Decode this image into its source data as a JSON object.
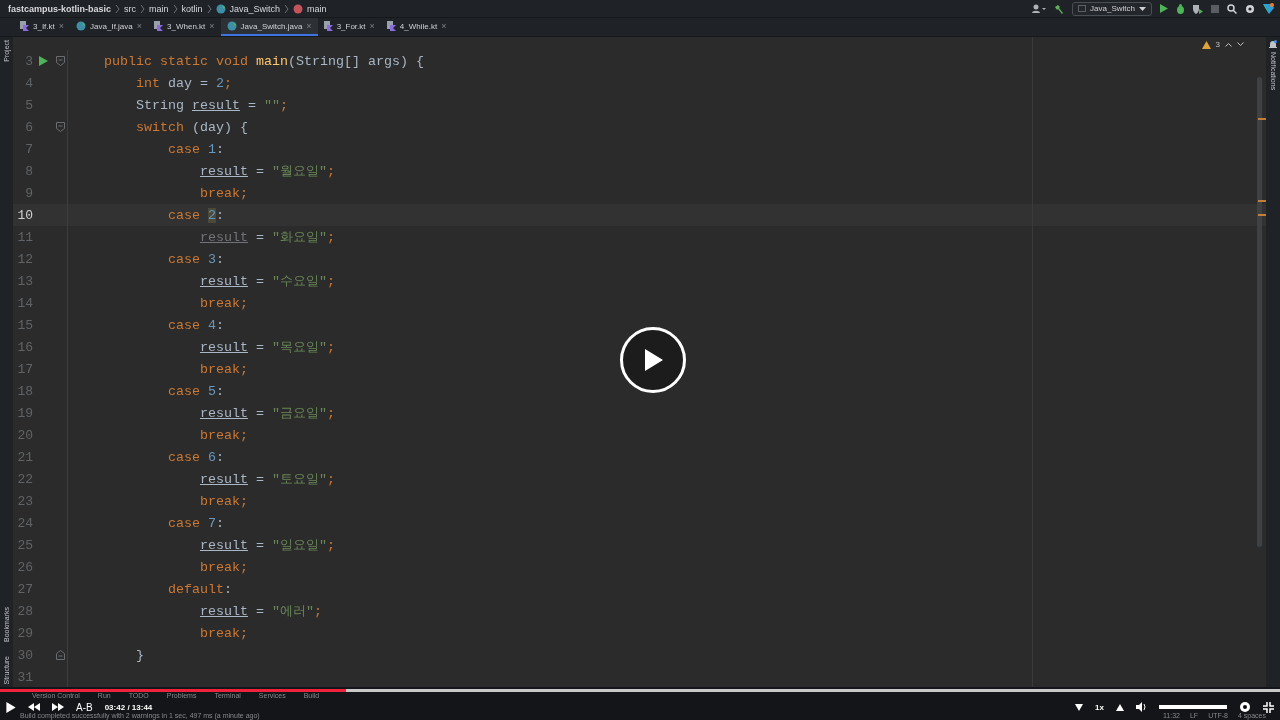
{
  "breadcrumbs": [
    {
      "label": "fastcampus-kotlin-basic",
      "kind": "project"
    },
    {
      "label": "src",
      "kind": "folder"
    },
    {
      "label": "main",
      "kind": "folder"
    },
    {
      "label": "kotlin",
      "kind": "folder"
    },
    {
      "label": "Java_Switch",
      "kind": "class"
    },
    {
      "label": "main",
      "kind": "method"
    }
  ],
  "run_config": {
    "label": "Java_Switch"
  },
  "tabs": [
    {
      "label": "3_If.kt",
      "kind": "kotlin",
      "close": "×",
      "selected": false
    },
    {
      "label": "Java_If.java",
      "kind": "java",
      "close": "×",
      "selected": false
    },
    {
      "label": "3_When.kt",
      "kind": "kotlin",
      "close": "×",
      "selected": false
    },
    {
      "label": "Java_Switch.java",
      "kind": "java",
      "close": "×",
      "selected": true
    },
    {
      "label": "3_For.kt",
      "kind": "kotlin",
      "close": "×",
      "selected": false
    },
    {
      "label": "4_While.kt",
      "kind": "kotlin",
      "close": "×",
      "selected": false
    }
  ],
  "left_tools": {
    "top": "Project",
    "bottom": [
      "Bookmarks",
      "Structure"
    ]
  },
  "right_tools": {
    "top": "Notifications"
  },
  "inspections": {
    "warnings": "3"
  },
  "code_lines": [
    {
      "number": "3",
      "current": false,
      "run": true,
      "fold_start": true,
      "tokens": [
        {
          "text": "    public static void ",
          "kind": "kw"
        },
        {
          "text": "main",
          "kind": "fn"
        },
        {
          "text": "(String[] args) {",
          "kind": "plain"
        }
      ]
    },
    {
      "number": "4",
      "current": false,
      "tokens": [
        {
          "text": "        int",
          "kind": "kw"
        },
        {
          "text": " day = ",
          "kind": "plain"
        },
        {
          "text": "2",
          "kind": "num"
        },
        {
          "text": ";",
          "kind": "kw"
        }
      ]
    },
    {
      "number": "5",
      "current": false,
      "tokens": [
        {
          "text": "        String ",
          "kind": "plain"
        },
        {
          "text": "result",
          "kind": "var"
        },
        {
          "text": " = ",
          "kind": "plain"
        },
        {
          "text": "\"\"",
          "kind": "str"
        },
        {
          "text": ";",
          "kind": "kw"
        }
      ]
    },
    {
      "number": "6",
      "current": false,
      "fold_start": true,
      "tokens": [
        {
          "text": "        switch",
          "kind": "kw"
        },
        {
          "text": " (day) {",
          "kind": "plain"
        }
      ]
    },
    {
      "number": "7",
      "current": false,
      "tokens": [
        {
          "text": "            case ",
          "kind": "kw"
        },
        {
          "text": "1",
          "kind": "num"
        },
        {
          "text": ":",
          "kind": "plain"
        }
      ]
    },
    {
      "number": "8",
      "current": false,
      "tokens": [
        {
          "text": "                result",
          "kind": "var"
        },
        {
          "text": " = ",
          "kind": "plain"
        },
        {
          "text": "\"월요일\"",
          "kind": "str"
        },
        {
          "text": ";",
          "kind": "kw"
        }
      ]
    },
    {
      "number": "9",
      "current": false,
      "tokens": [
        {
          "text": "                break;",
          "kind": "kw"
        }
      ]
    },
    {
      "number": "10",
      "current": true,
      "tokens": [
        {
          "text": "            case ",
          "kind": "kw"
        },
        {
          "text": "2",
          "kind": "num_hl"
        },
        {
          "text": ":",
          "kind": "plain"
        }
      ]
    },
    {
      "number": "11",
      "current": false,
      "tokens": [
        {
          "text": "                result",
          "kind": "unused"
        },
        {
          "text": " = ",
          "kind": "plain"
        },
        {
          "text": "\"화요일\"",
          "kind": "str"
        },
        {
          "text": ";",
          "kind": "kw"
        }
      ]
    },
    {
      "number": "12",
      "current": false,
      "tokens": [
        {
          "text": "            case ",
          "kind": "kw"
        },
        {
          "text": "3",
          "kind": "num"
        },
        {
          "text": ":",
          "kind": "plain"
        }
      ]
    },
    {
      "number": "13",
      "current": false,
      "tokens": [
        {
          "text": "                result",
          "kind": "var"
        },
        {
          "text": " = ",
          "kind": "plain"
        },
        {
          "text": "\"수요일\"",
          "kind": "str"
        },
        {
          "text": ";",
          "kind": "kw"
        }
      ]
    },
    {
      "number": "14",
      "current": false,
      "tokens": [
        {
          "text": "                break;",
          "kind": "kw"
        }
      ]
    },
    {
      "number": "15",
      "current": false,
      "tokens": [
        {
          "text": "            case ",
          "kind": "kw"
        },
        {
          "text": "4",
          "kind": "num"
        },
        {
          "text": ":",
          "kind": "plain"
        }
      ]
    },
    {
      "number": "16",
      "current": false,
      "tokens": [
        {
          "text": "                result",
          "kind": "var"
        },
        {
          "text": " = ",
          "kind": "plain"
        },
        {
          "text": "\"목요일\"",
          "kind": "str"
        },
        {
          "text": ";",
          "kind": "kw"
        }
      ]
    },
    {
      "number": "17",
      "current": false,
      "tokens": [
        {
          "text": "                break;",
          "kind": "kw"
        }
      ]
    },
    {
      "number": "18",
      "current": false,
      "tokens": [
        {
          "text": "            case ",
          "kind": "kw"
        },
        {
          "text": "5",
          "kind": "num"
        },
        {
          "text": ":",
          "kind": "plain"
        }
      ]
    },
    {
      "number": "19",
      "current": false,
      "tokens": [
        {
          "text": "                result",
          "kind": "var"
        },
        {
          "text": " = ",
          "kind": "plain"
        },
        {
          "text": "\"금요일\"",
          "kind": "str"
        },
        {
          "text": ";",
          "kind": "kw"
        }
      ]
    },
    {
      "number": "20",
      "current": false,
      "tokens": [
        {
          "text": "                break;",
          "kind": "kw"
        }
      ]
    },
    {
      "number": "21",
      "current": false,
      "tokens": [
        {
          "text": "            case ",
          "kind": "kw"
        },
        {
          "text": "6",
          "kind": "num"
        },
        {
          "text": ":",
          "kind": "plain"
        }
      ]
    },
    {
      "number": "22",
      "current": false,
      "tokens": [
        {
          "text": "                result",
          "kind": "var"
        },
        {
          "text": " = ",
          "kind": "plain"
        },
        {
          "text": "\"토요일\"",
          "kind": "str"
        },
        {
          "text": ";",
          "kind": "kw"
        }
      ]
    },
    {
      "number": "23",
      "current": false,
      "tokens": [
        {
          "text": "                break;",
          "kind": "kw"
        }
      ]
    },
    {
      "number": "24",
      "current": false,
      "tokens": [
        {
          "text": "            case ",
          "kind": "kw"
        },
        {
          "text": "7",
          "kind": "num"
        },
        {
          "text": ":",
          "kind": "plain"
        }
      ]
    },
    {
      "number": "25",
      "current": false,
      "tokens": [
        {
          "text": "                result",
          "kind": "var"
        },
        {
          "text": " = ",
          "kind": "plain"
        },
        {
          "text": "\"일요일\"",
          "kind": "str"
        },
        {
          "text": ";",
          "kind": "kw"
        }
      ]
    },
    {
      "number": "26",
      "current": false,
      "tokens": [
        {
          "text": "                break;",
          "kind": "kw"
        }
      ]
    },
    {
      "number": "27",
      "current": false,
      "tokens": [
        {
          "text": "            default",
          "kind": "kw"
        },
        {
          "text": ":",
          "kind": "plain"
        }
      ]
    },
    {
      "number": "28",
      "current": false,
      "tokens": [
        {
          "text": "                result",
          "kind": "var"
        },
        {
          "text": " = ",
          "kind": "plain"
        },
        {
          "text": "\"에러\"",
          "kind": "str"
        },
        {
          "text": ";",
          "kind": "kw"
        }
      ]
    },
    {
      "number": "29",
      "current": false,
      "tokens": [
        {
          "text": "                break;",
          "kind": "kw"
        }
      ]
    },
    {
      "number": "30",
      "current": false,
      "fold_end": true,
      "tokens": [
        {
          "text": "        }",
          "kind": "plain"
        }
      ]
    },
    {
      "number": "31",
      "current": false
    }
  ],
  "tool_windows": [
    "Version Control",
    "Run",
    "TODO",
    "Problems",
    "Terminal",
    "Services",
    "Build"
  ],
  "status": {
    "message": "Build completed successfully with 2 warnings in 1 sec, 497 ms (a minute ago)",
    "position": "11:32",
    "line_ending": "LF",
    "encoding": "UTF-8",
    "indent": "4 spaces"
  },
  "player": {
    "progress": {
      "level": 0.27
    },
    "ab_label": "A-B",
    "current_time": "03:42",
    "separator": "/",
    "duration": "13:44",
    "speed": "1x",
    "volume": {
      "level": 1
    }
  }
}
